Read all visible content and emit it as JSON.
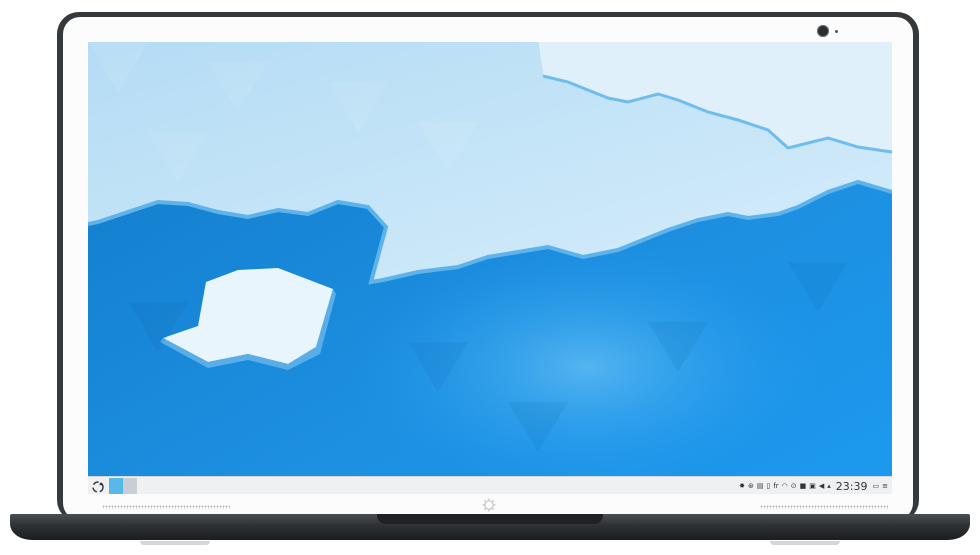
{
  "taskbar": {
    "keyboard_layout": "fr",
    "clock": "23:39"
  },
  "tray_icons": [
    "notifications-icon",
    "clipboard-icon",
    "usb-icon",
    "battery-icon",
    "keyboard-layout-indicator",
    "wifi-icon",
    "media-player-icon",
    "display-icon",
    "vault-icon",
    "volume-icon",
    "expand-tray-icon"
  ],
  "colors": {
    "sky": "#1d99f3",
    "ice": "#c8e6f8",
    "panel": "#eff0f1",
    "bezel": "#36393c"
  }
}
